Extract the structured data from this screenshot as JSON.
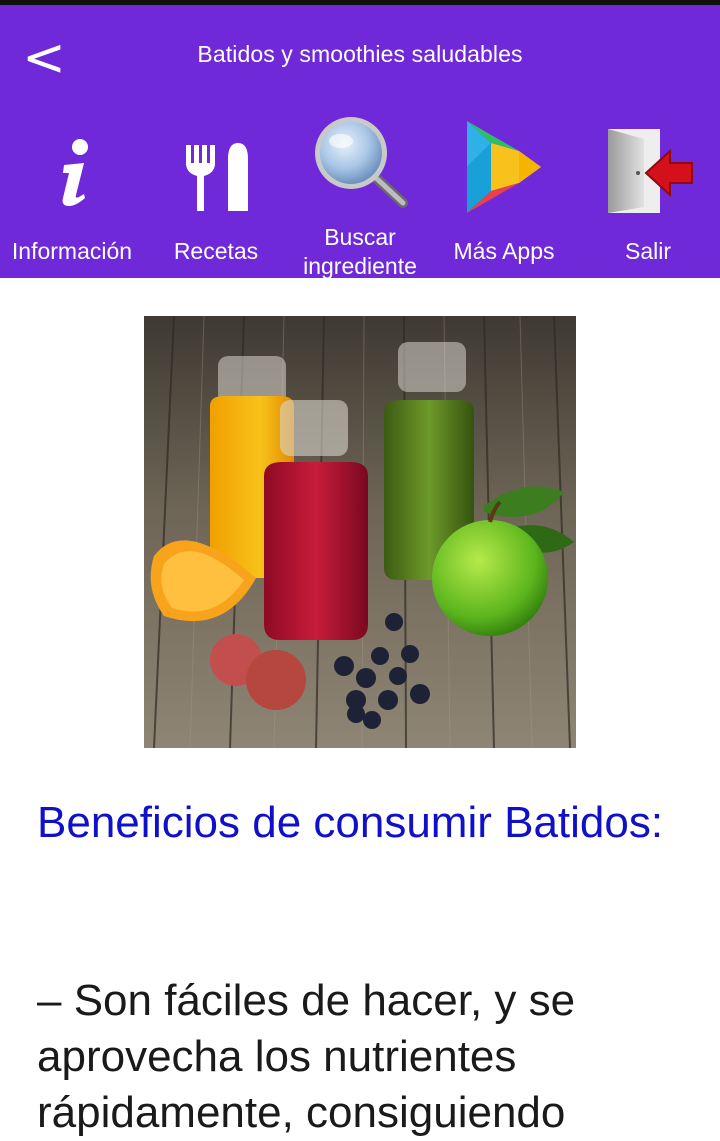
{
  "header": {
    "title": "Batidos y smoothies saludables",
    "back_symbol": "<",
    "background_color": "#7029d8"
  },
  "toolbar": {
    "items": [
      {
        "label": "Información",
        "icon": "info-icon"
      },
      {
        "label": "Recetas",
        "icon": "fork-knife-icon"
      },
      {
        "label": "Buscar ingrediente",
        "icon": "magnifier-icon"
      },
      {
        "label": "Más Apps",
        "icon": "play-store-icon"
      },
      {
        "label": "Salir",
        "icon": "exit-door-icon"
      }
    ]
  },
  "main": {
    "image": "smoothie-bottles-image",
    "heading": "Beneficios de consumir Batidos:",
    "heading_color": "#1010c8",
    "paragraph": "– Son fáciles de hacer, y se aprovecha los nutrientes rápidamente, consiguiendo"
  }
}
